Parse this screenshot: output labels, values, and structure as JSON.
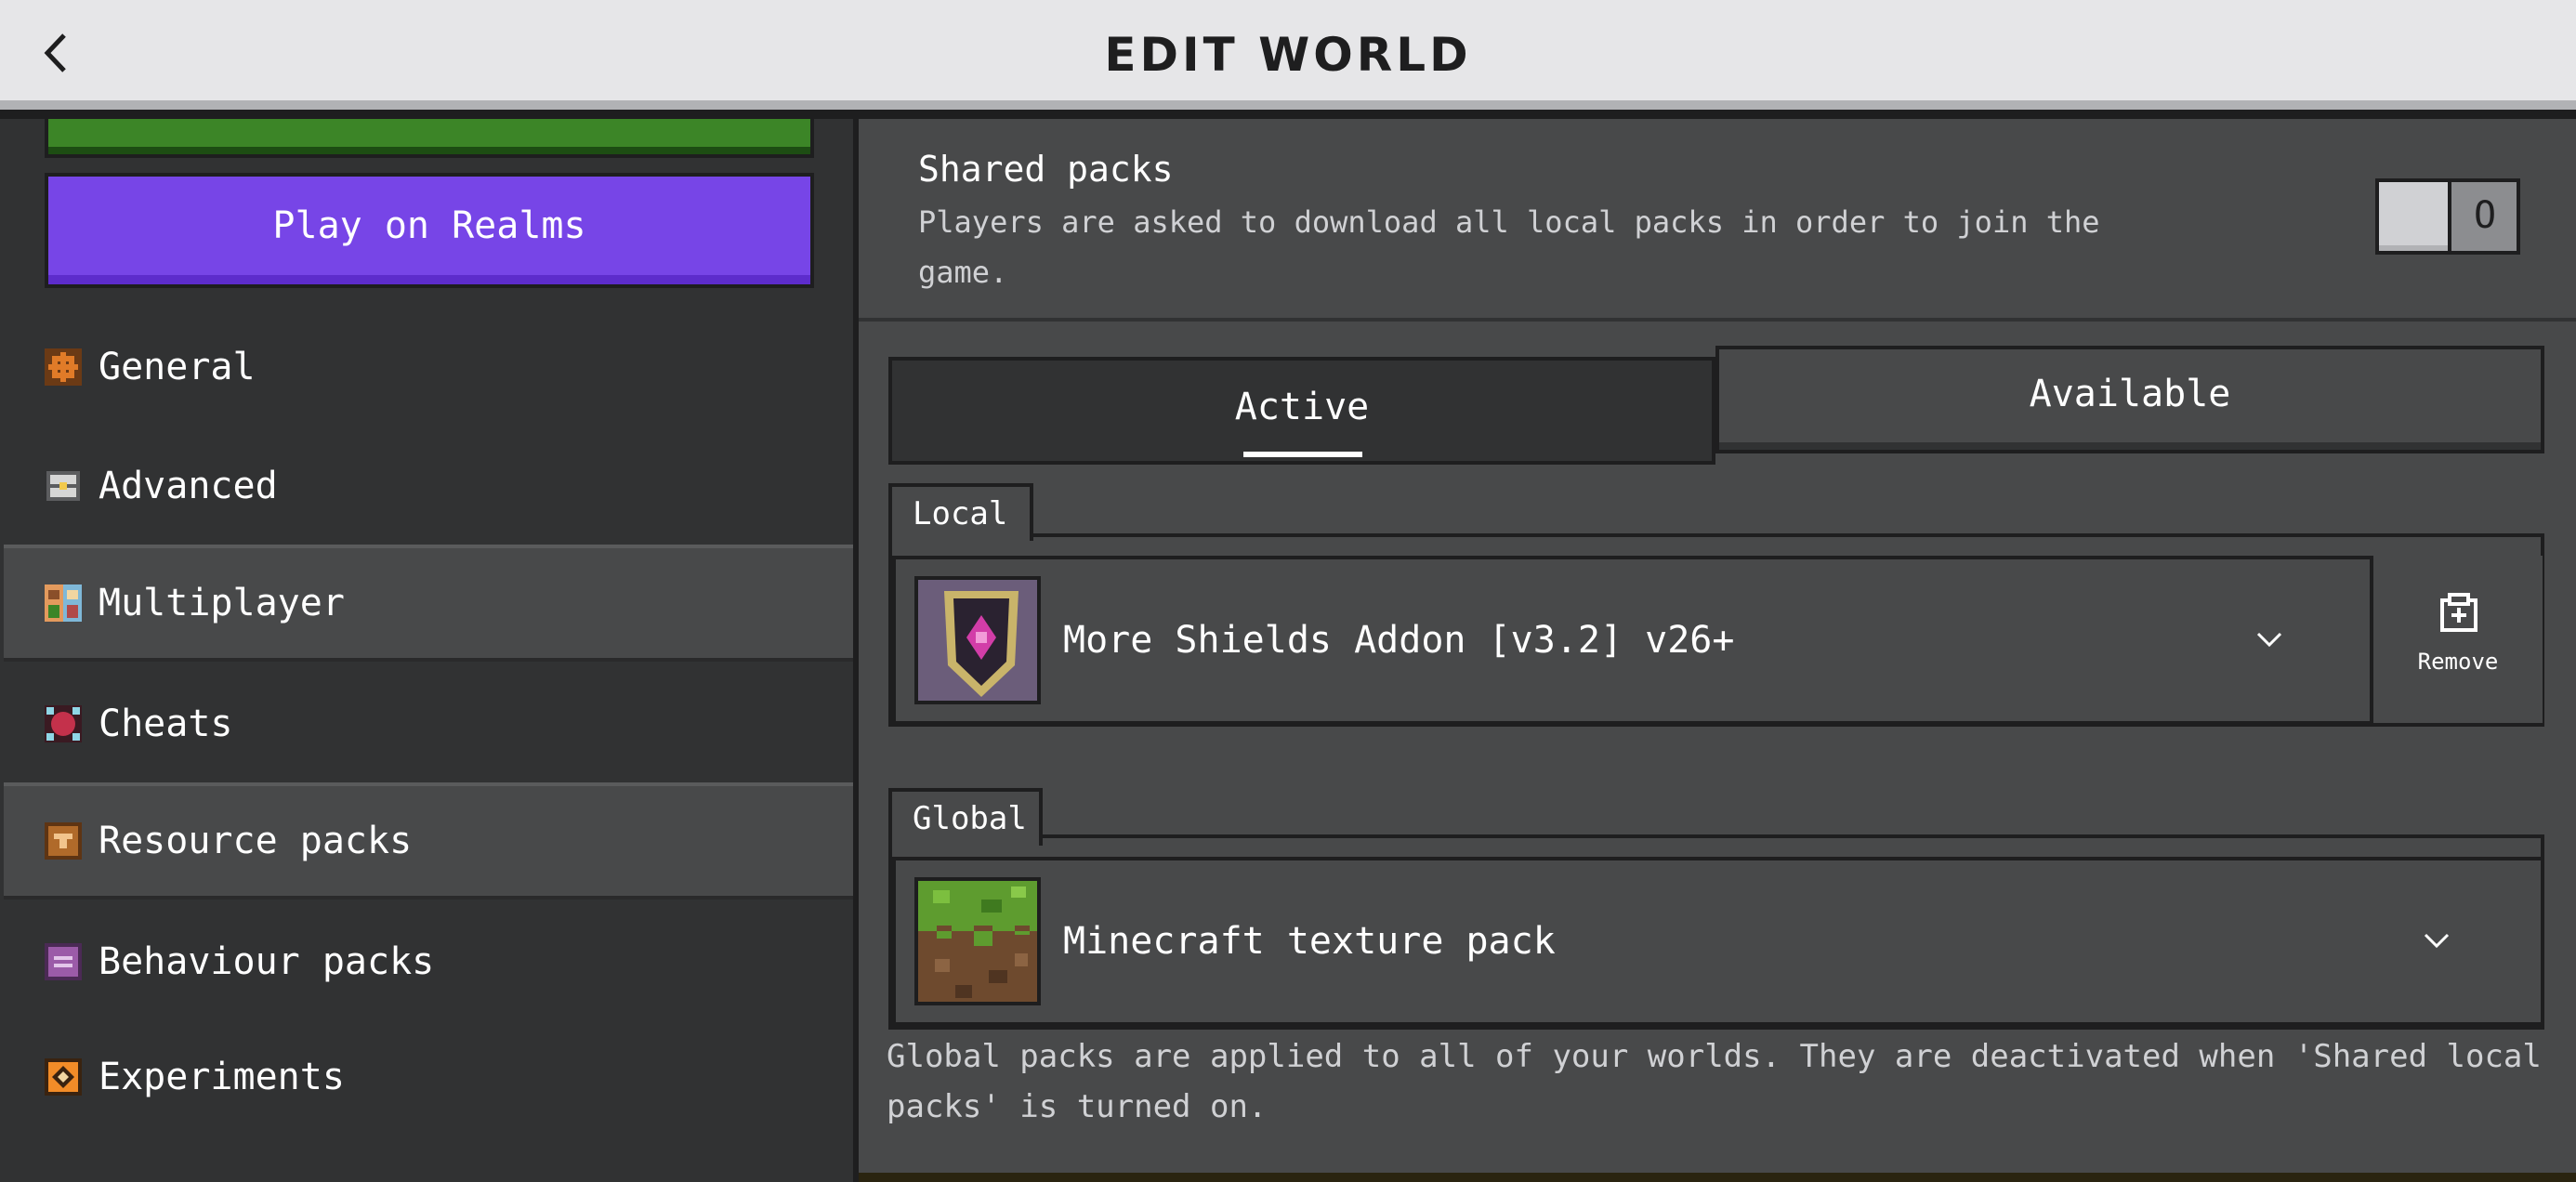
{
  "header": {
    "title": "EDIT WORLD",
    "back_icon": "chevron-left-icon"
  },
  "sidebar": {
    "realms_button": "Play on Realms",
    "items": [
      {
        "label": "General",
        "icon": "gear-icon",
        "color": "#e07b28"
      },
      {
        "label": "Advanced",
        "icon": "chest-icon",
        "color": "#d6d6d6"
      },
      {
        "label": "Multiplayer",
        "icon": "players-icon",
        "color": "#e39a5d"
      },
      {
        "label": "Cheats",
        "icon": "cheats-icon",
        "color": "#c4314b"
      },
      {
        "label": "Resource packs",
        "icon": "resource-pack-icon",
        "color": "#b06a2a"
      },
      {
        "label": "Behaviour packs",
        "icon": "behaviour-pack-icon",
        "color": "#9b5ba8"
      },
      {
        "label": "Experiments",
        "icon": "experiments-icon",
        "color": "#f28c28"
      }
    ],
    "selected_items": [
      "Multiplayer",
      "Resource packs"
    ]
  },
  "shared_packs": {
    "title": "Shared packs",
    "description": "Players are asked to download all local packs in order to join the game.",
    "toggle_state": "O",
    "enabled": false
  },
  "tabs": {
    "active": "Active",
    "available": "Available",
    "selected": "Active"
  },
  "local": {
    "label": "Local",
    "packs": [
      {
        "name": "More Shields Addon [v3.2] v26+",
        "remove_label": "Remove"
      }
    ]
  },
  "global": {
    "label": "Global",
    "packs": [
      {
        "name": "Minecraft texture pack"
      }
    ],
    "note": "Global packs are applied to all of your worlds. They are deactivated when 'Shared local packs' is turned on."
  },
  "colors": {
    "header_bg": "#e6e6e8",
    "sidebar_bg": "#313233",
    "panel_bg": "#48494a",
    "realms_purple": "#7745e7",
    "play_green": "#3c8527"
  }
}
